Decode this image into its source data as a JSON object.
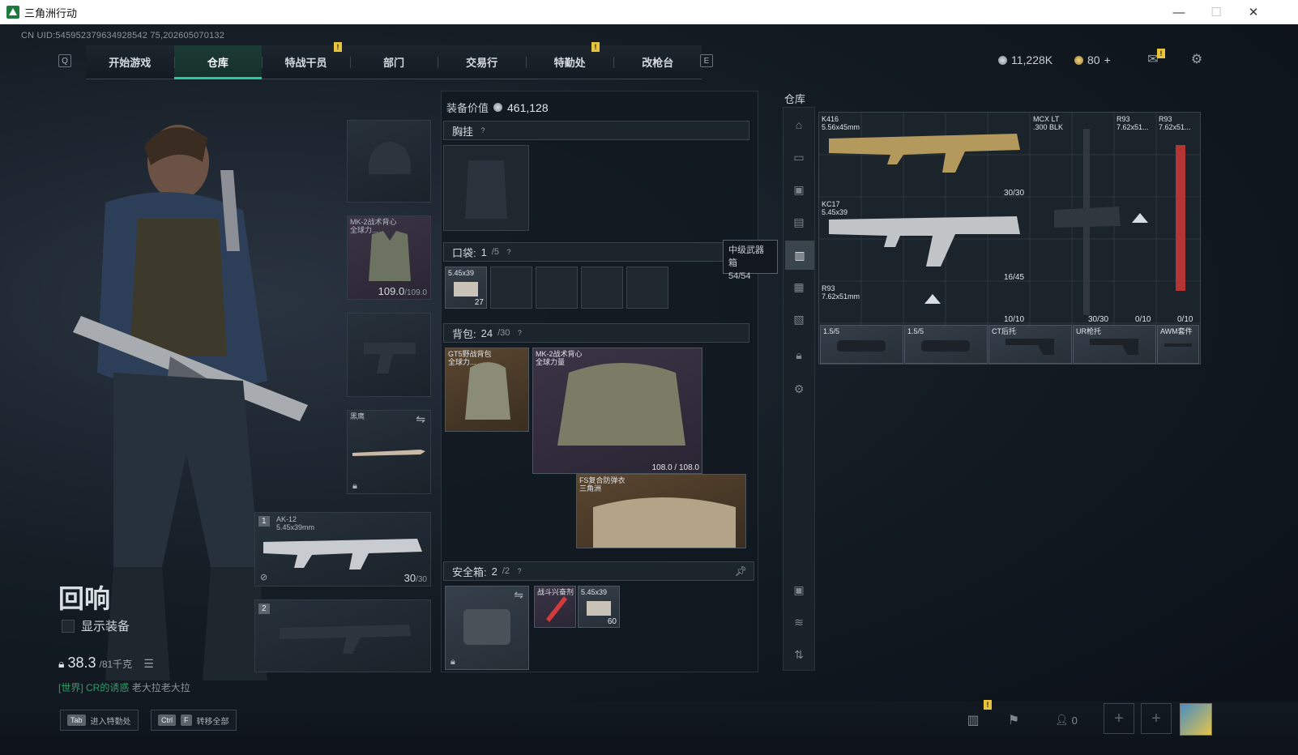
{
  "window": {
    "title": "三角洲行动",
    "minimize": "—",
    "maximize": "☐",
    "close": "✕"
  },
  "uid": "CN UID:545952379634928542 75,202605070132",
  "nav": {
    "left_key": "Q",
    "right_key": "E",
    "tabs": [
      "开始游戏",
      "仓库",
      "特战干员",
      "部门",
      "交易行",
      "特勤处",
      "改枪台"
    ],
    "active": "仓库",
    "badge": "!"
  },
  "currency": {
    "silver": "11,228K",
    "gold": "80",
    "plus": "+"
  },
  "topbar_icons": [
    "mail-icon",
    "settings-icon"
  ],
  "character": {
    "name": "回响",
    "show_gear_label": "显示装备",
    "weight": "38.3",
    "weight_max": "/81千克"
  },
  "chat": {
    "channel": "[世界]",
    "message": "CR的诱惑",
    "sender": "老大拉老大拉"
  },
  "equip_slots": {
    "vest": {
      "label": "MK-2战术背心",
      "sub": "全球力...",
      "value": "109.0",
      "max": "/109.0"
    },
    "melee": {
      "label": "黑鹰"
    },
    "primary": {
      "index": "1",
      "label": "AK-12",
      "ammo_type": "5.45x39mm",
      "ammo": "30",
      "ammo_max": "/30"
    },
    "secondary": {
      "index": "2"
    }
  },
  "equip_panel": {
    "value_label": "装备价值",
    "value": "461,128",
    "chest_rig": {
      "label": "胸挂"
    },
    "pockets": {
      "label": "口袋:",
      "count": "1",
      "max": "/5"
    },
    "pocket_item": {
      "label": "5.45x39",
      "count": "27"
    },
    "backpack": {
      "label": "背包:",
      "count": "24",
      "max": "/30"
    },
    "backpack_items": [
      {
        "label": "GT5野战背包",
        "sub": "全球力..."
      },
      {
        "label": "MK-2战术背心",
        "sub": "全球力量",
        "count": "108.0 / 108.0"
      },
      {
        "label": "FS复合防弹衣",
        "sub": "三角洲"
      }
    ],
    "safebox": {
      "label": "安全箱:",
      "count": "2",
      "max": "/2"
    },
    "safebox_items": [
      {
        "label": "战斗兴奋剂"
      },
      {
        "label": "5.45x39",
        "count": "60"
      }
    ]
  },
  "tooltip": {
    "title": "中级武器箱",
    "value": "54/54"
  },
  "storage": {
    "title": "仓库",
    "weapons": [
      {
        "name": "K416",
        "ammo": "5.56x45mm",
        "count": "30/30"
      },
      {
        "name": "KC17",
        "ammo": "5.45x39",
        "count": "16/45"
      },
      {
        "name": "R93",
        "ammo": "7.62x51mm",
        "count": "10/10"
      },
      {
        "name": "MCX LT",
        "ammo": ".300 BLK",
        "count": "30/30"
      },
      {
        "name": "R93",
        "ammo": "7.62x51...",
        "count": "0/10"
      },
      {
        "name": "R93",
        "ammo": "7.62x51...",
        "count": "0/10"
      }
    ],
    "attachments": [
      "1.5/5",
      "1.5/5",
      "CT后托",
      "UR枪托",
      "AWM套件"
    ]
  },
  "bottom": {
    "hint1_key": "Tab",
    "hint1_label": "进入特勤处",
    "hint2_key1": "Ctrl",
    "hint2_key2": "F",
    "hint2_label": "转移全部",
    "friends_count": "0"
  }
}
